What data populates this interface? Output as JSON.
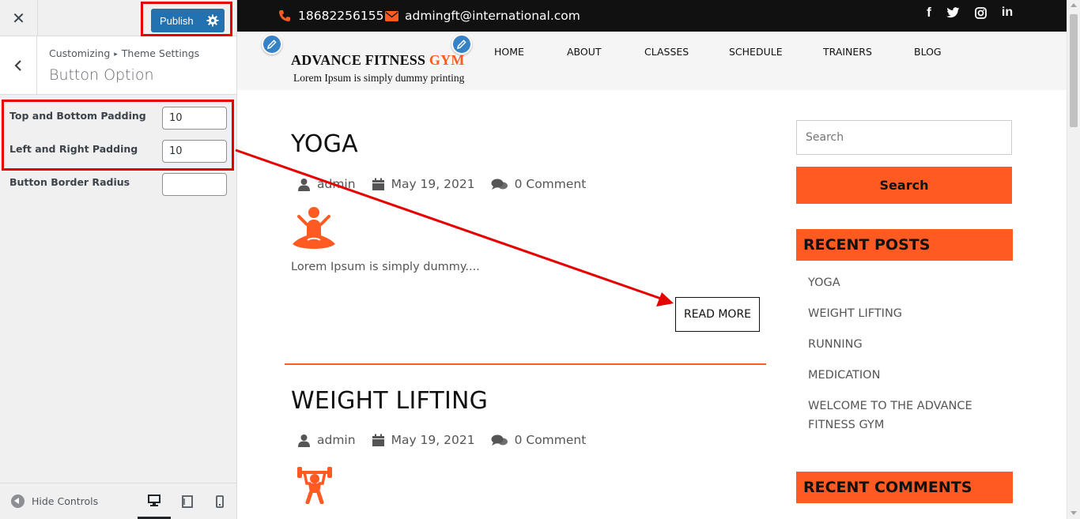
{
  "customizer": {
    "close_icon": "close-icon",
    "publish_label": "Publish",
    "breadcrumb": [
      "Customizing",
      "Theme Settings"
    ],
    "section_title": "Button Option",
    "controls": [
      {
        "label": "Top and Bottom Padding",
        "value": "10"
      },
      {
        "label": "Left and Right Padding",
        "value": "10"
      },
      {
        "label": "Button Border Radius",
        "value": ""
      }
    ],
    "hide_controls_label": "Hide Controls",
    "devices": [
      "desktop",
      "tablet",
      "mobile"
    ],
    "active_device": "desktop"
  },
  "site": {
    "topbar": {
      "phone": "18682256155",
      "email": "admingft@international.com",
      "social": [
        "facebook",
        "twitter",
        "instagram",
        "linkedin"
      ]
    },
    "logo": {
      "title": "ADVANCE FITNESS",
      "title_highlight": "GYM",
      "tagline": "Lorem Ipsum is simply dummy printing"
    },
    "nav": [
      "HOME",
      "ABOUT",
      "CLASSES",
      "SCHEDULE",
      "TRAINERS",
      "BLOG"
    ],
    "posts": [
      {
        "title": "YOGA",
        "author": "admin",
        "date": "May 19, 2021",
        "comments": "0 Comment",
        "icon": "yoga-icon",
        "excerpt": "Lorem Ipsum is simply dummy....",
        "read_more": "READ MORE"
      },
      {
        "title": "WEIGHT LIFTING",
        "author": "admin",
        "date": "May 19, 2021",
        "comments": "0 Comment",
        "icon": "weightlifting-icon"
      }
    ],
    "sidebar": {
      "search_placeholder": "Search",
      "search_button": "Search",
      "recent_posts_title": "RECENT POSTS",
      "recent_posts": [
        "YOGA",
        "WEIGHT LIFTING",
        "RUNNING",
        "MEDICATION",
        "WELCOME TO THE ADVANCE FITNESS GYM"
      ],
      "recent_comments_title": "RECENT COMMENTS"
    }
  },
  "colors": {
    "accent": "#ff5a22",
    "publish_blue": "#2271b1",
    "annotation_red": "#e60000",
    "topbar_bg": "#111111"
  }
}
